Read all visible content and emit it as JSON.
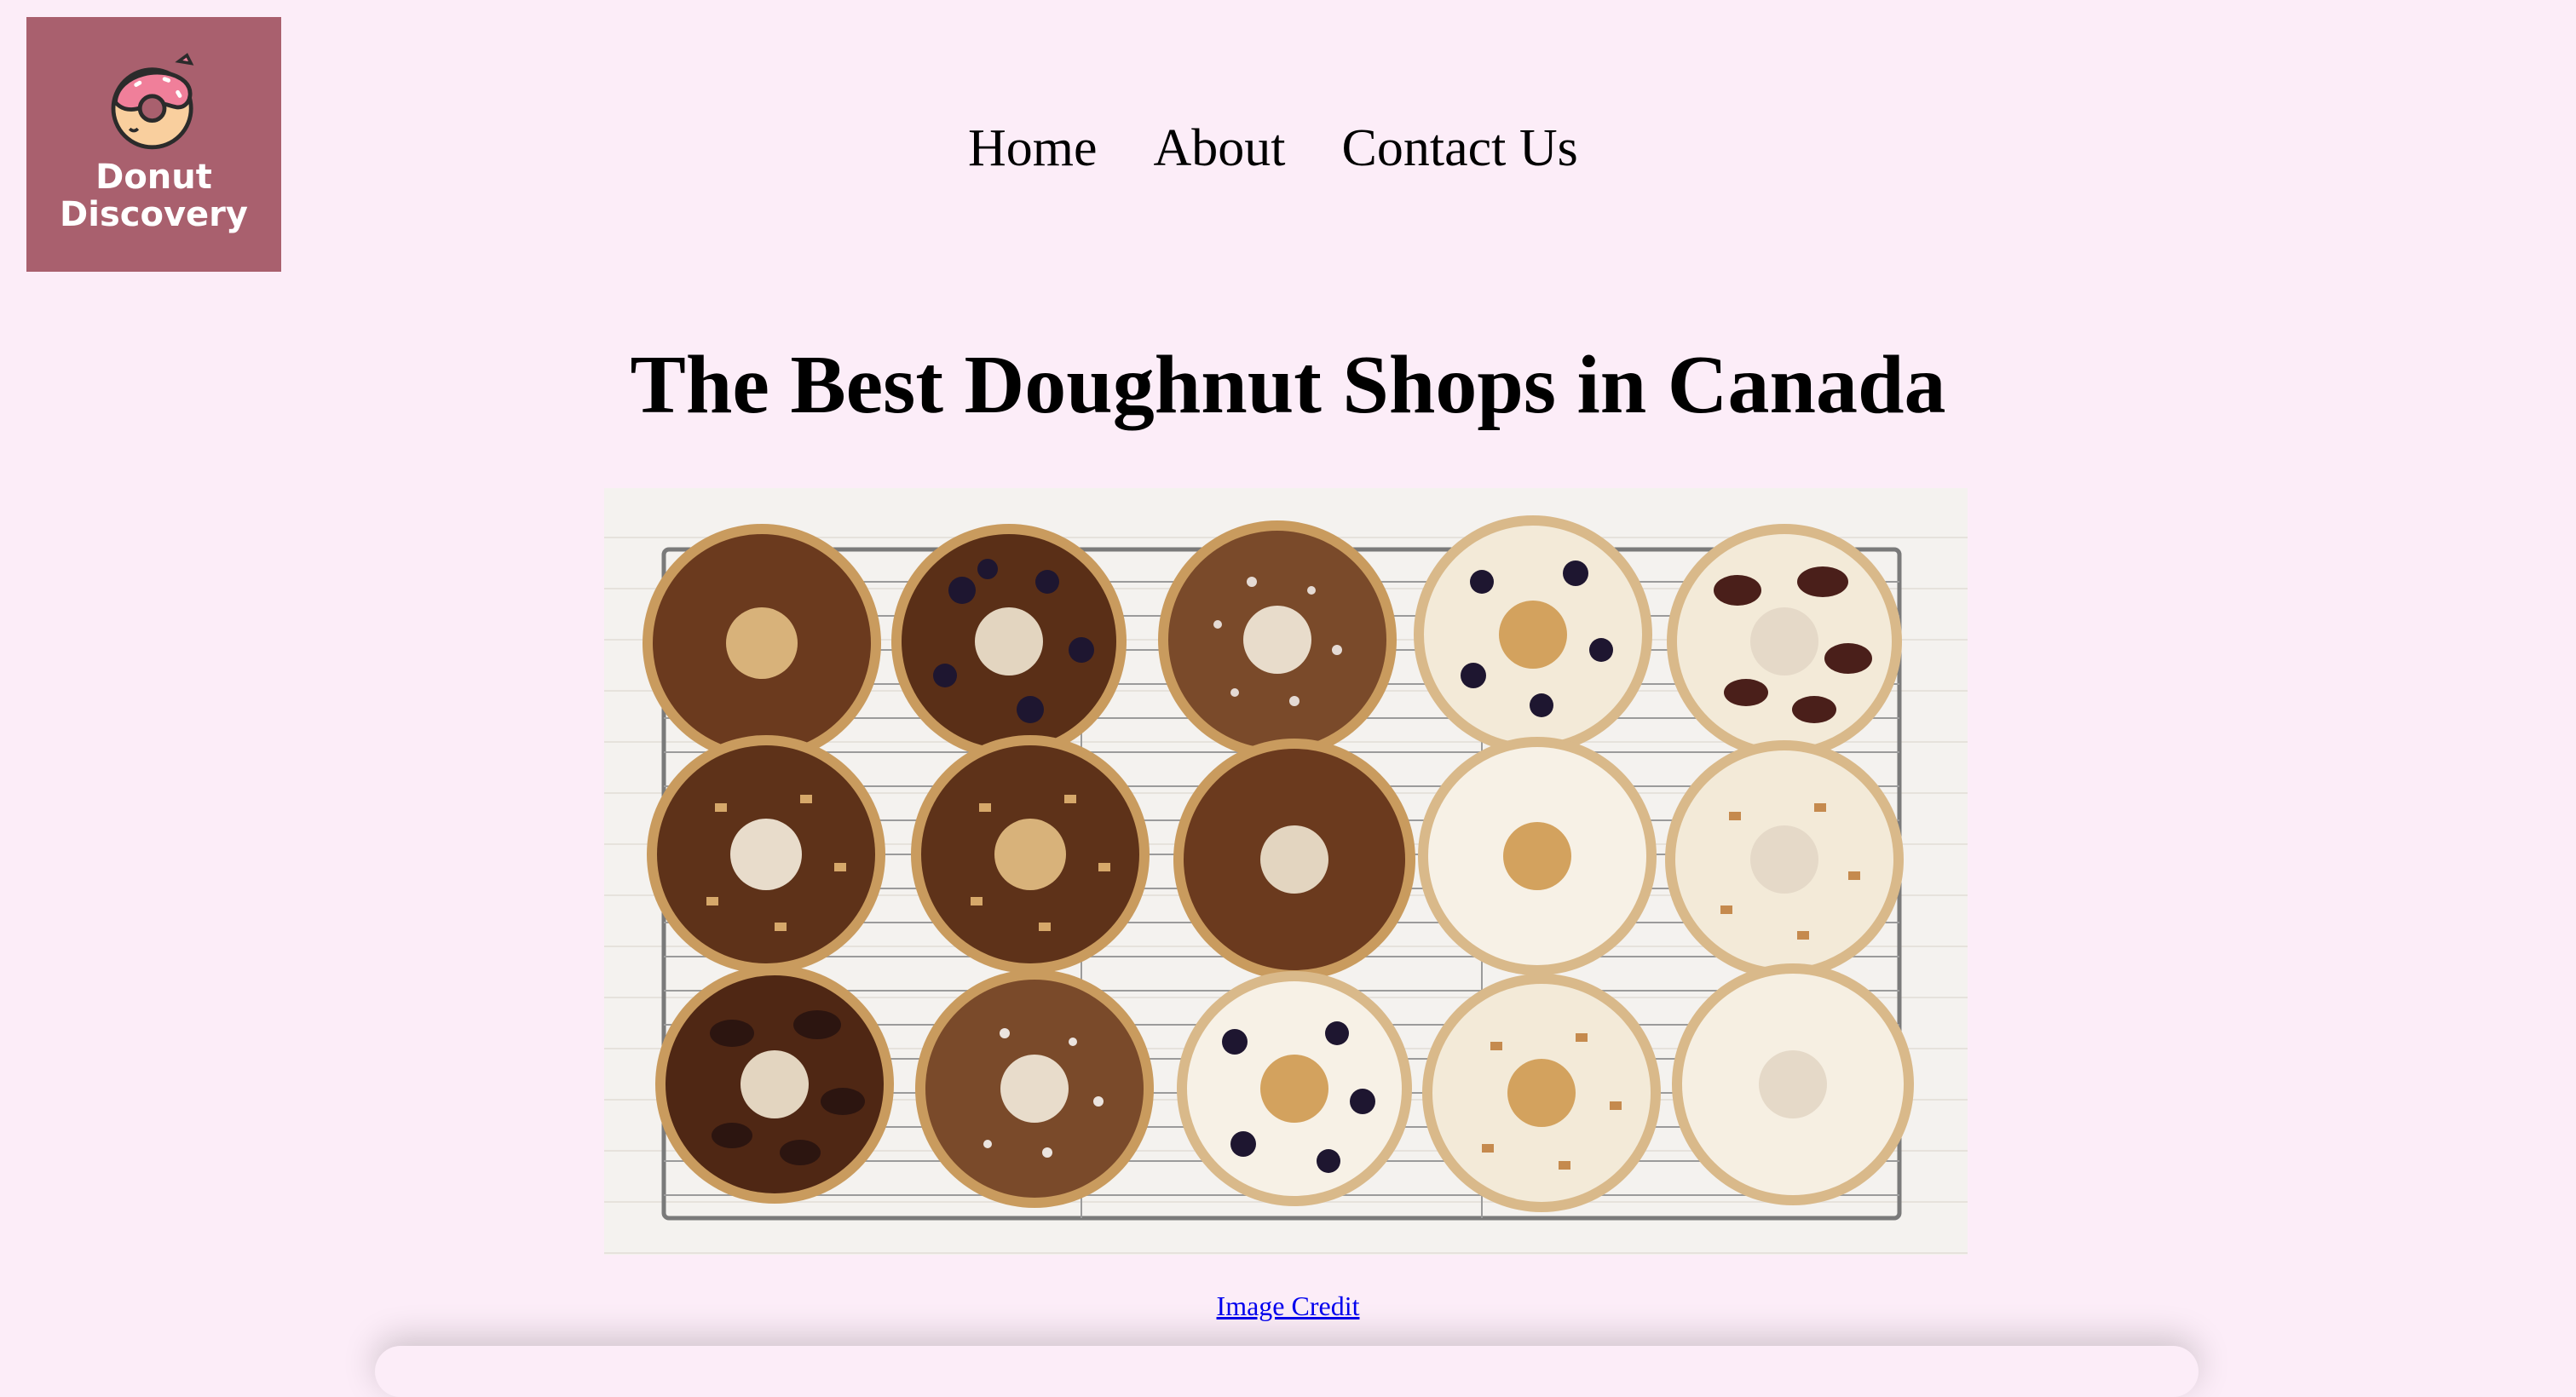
{
  "logo": {
    "line1": "Donut",
    "line2": "Discovery",
    "icon": "donut-icon",
    "bg_color": "#a9606e"
  },
  "nav": {
    "home": "Home",
    "about": "About",
    "contact": "Contact Us"
  },
  "main": {
    "title": "The Best Doughnut Shops in Canada",
    "image_alt": "donuts-on-cooling-rack-image",
    "credit_link": "Image Credit"
  },
  "colors": {
    "page_bg": "#fcedf8",
    "link": "#0000ee"
  }
}
